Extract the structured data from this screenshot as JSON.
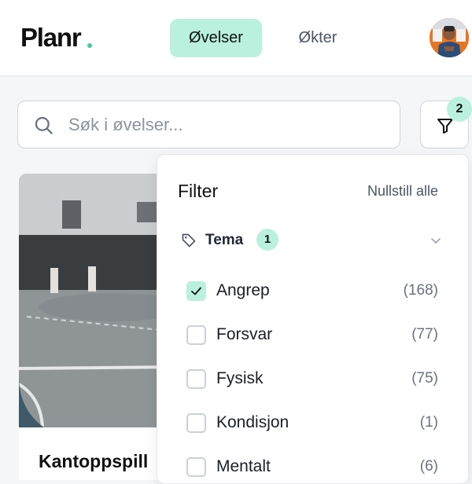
{
  "header": {
    "logo": "Planr",
    "tabs": [
      {
        "label": "Øvelser",
        "active": true
      },
      {
        "label": "Økter",
        "active": false
      }
    ]
  },
  "search": {
    "placeholder": "Søk i øvelser...",
    "value": ""
  },
  "filter_button": {
    "badge": "2",
    "icon": "funnel-icon"
  },
  "card": {
    "title": "Kantoppspill"
  },
  "filter_panel": {
    "title": "Filter",
    "reset_label": "Nullstill alle",
    "section": {
      "label": "Tema",
      "badge": "1",
      "icon": "tag-icon"
    },
    "options": [
      {
        "label": "Angrep",
        "count": "(168)",
        "checked": true
      },
      {
        "label": "Forsvar",
        "count": "(77)",
        "checked": false
      },
      {
        "label": "Fysisk",
        "count": "(75)",
        "checked": false
      },
      {
        "label": "Kondisjon",
        "count": "(1)",
        "checked": false
      },
      {
        "label": "Mentalt",
        "count": "(6)",
        "checked": false
      }
    ]
  },
  "colors": {
    "accent": "#b9f1de",
    "logo_dot": "#47c9a2"
  }
}
